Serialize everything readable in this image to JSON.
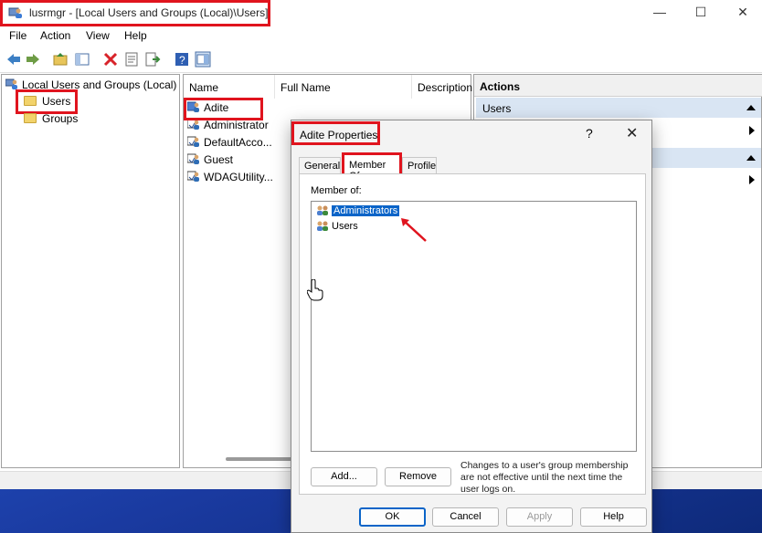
{
  "window": {
    "title": "lusrmgr - [Local Users and Groups (Local)\\Users]",
    "controls": {
      "minimize": "—",
      "maximize": "☐",
      "close": "✕"
    }
  },
  "menu": {
    "items": [
      "File",
      "Action",
      "View",
      "Help"
    ]
  },
  "toolbar": {
    "icons": [
      "back-icon",
      "forward-icon",
      "up-folder-icon",
      "show-hide-tree-icon",
      "delete-icon",
      "properties-icon",
      "export-list-icon",
      "help-icon",
      "show-action-pane-icon"
    ]
  },
  "tree": {
    "root": "Local Users and Groups (Local)",
    "children": [
      "Users",
      "Groups"
    ]
  },
  "list": {
    "columns": [
      "Name",
      "Full Name",
      "Description"
    ],
    "rows": [
      "Adite",
      "Administrator",
      "DefaultAcco...",
      "Guest",
      "WDAGUtility..."
    ]
  },
  "actions": {
    "header": "Actions",
    "sections": [
      "Users",
      ""
    ]
  },
  "dialog": {
    "title": "Adite Properties",
    "help": "?",
    "close": "✕",
    "tabs": [
      "General",
      "Member Of",
      "Profile"
    ],
    "active_tab": "Member Of",
    "member_of_label": "Member of:",
    "groups": [
      "Administrators",
      "Users"
    ],
    "selected_group": "Administrators",
    "add_button": "Add...",
    "remove_button": "Remove",
    "note": "Changes to a user's group membership are not effective until the next time the user logs on.",
    "ok_button": "OK",
    "cancel_button": "Cancel",
    "apply_button": "Apply",
    "help_button": "Help"
  },
  "colors": {
    "highlight": "#e0141e",
    "selection": "#0a64c8",
    "action_section": "#d9e5f3"
  }
}
